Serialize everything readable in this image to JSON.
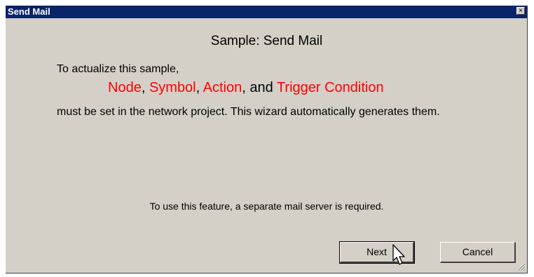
{
  "window": {
    "title": "Send Mail",
    "close_glyph": "×"
  },
  "content": {
    "heading": "Sample: Send Mail",
    "intro": "To actualize this sample,",
    "terms": {
      "node": "Node",
      "sep1": ", ",
      "symbol": "Symbol",
      "sep2": ", ",
      "action": "Action",
      "sep3": ", and ",
      "trigger": "Trigger Condition"
    },
    "line2": "must be set in the network project. This wizard automatically generates them.",
    "note": "To use this feature, a separate mail server is required."
  },
  "buttons": {
    "next": "Next",
    "cancel": "Cancel"
  },
  "colors": {
    "titlebar": "#0a246a",
    "highlight": "#ff0000",
    "face": "#d4d0c8"
  },
  "icons": [
    "close-icon",
    "resize-grip-icon",
    "mouse-cursor-icon"
  ]
}
